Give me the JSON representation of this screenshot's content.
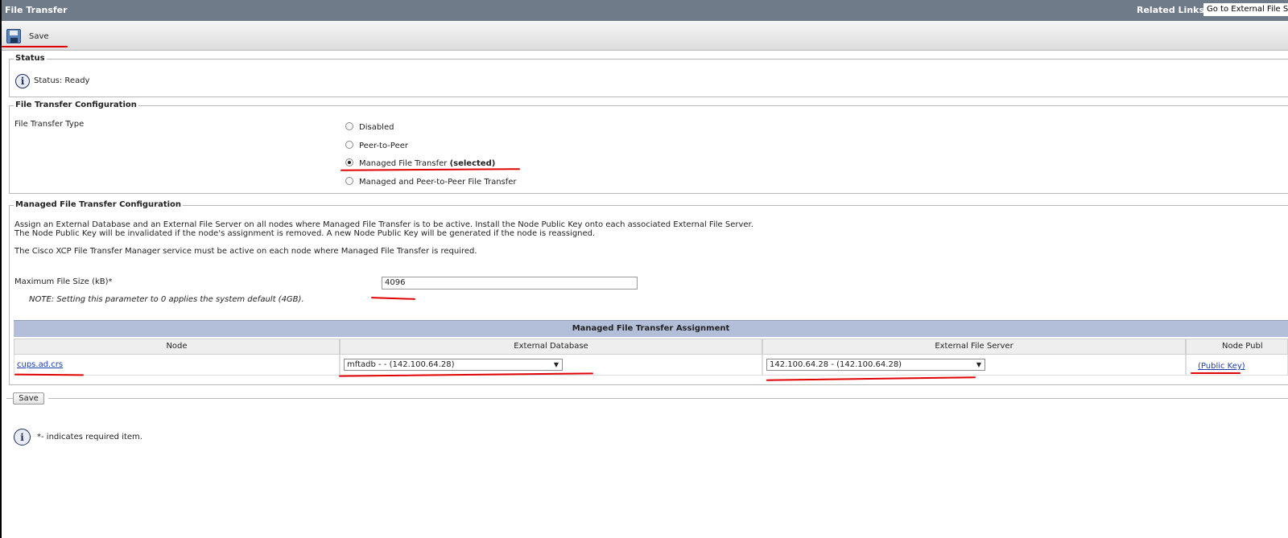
{
  "window": {
    "title": "File Transfer",
    "related_links_label": "Related Links:",
    "related_links_value": "Go to External File S"
  },
  "toolbar": {
    "save_label": "Save",
    "save_icon": "floppy-disk-icon"
  },
  "status": {
    "legend": "Status",
    "text": "Status: Ready",
    "icon": "info-icon"
  },
  "ft_config": {
    "legend": "File Transfer Configuration",
    "type_label": "File Transfer Type",
    "options": [
      {
        "label": "Disabled",
        "suffix": "",
        "checked": false
      },
      {
        "label": "Peer-to-Peer",
        "suffix": "",
        "checked": false
      },
      {
        "label": "Managed File Transfer",
        "suffix": "(selected)",
        "checked": true
      },
      {
        "label": "Managed and Peer-to-Peer File Transfer",
        "suffix": "",
        "checked": false
      }
    ]
  },
  "mft_config": {
    "legend": "Managed File Transfer Configuration",
    "desc_line1": "Assign an External Database and an External File Server on all nodes where Managed File Transfer is to be active. Install the Node Public Key onto each associated External File Server.",
    "desc_line2": "The Node Public Key will be invalidated if the node's assignment is removed. A new Node Public Key will be generated if the node is reassigned.",
    "desc_line3": "The Cisco XCP File Transfer Manager service must be active on each node where Managed File Transfer is required.",
    "max_size_label": "Maximum File Size (kB)*",
    "max_size_value": "4096",
    "note": "NOTE: Setting this parameter to 0 applies the system default (4GB)."
  },
  "assignment": {
    "title": "Managed File Transfer Assignment",
    "columns": [
      "Node",
      "External Database",
      "External File Server",
      "Node Publ"
    ],
    "rows": [
      {
        "node": "cups.ad.crs",
        "external_database": "mftadb - - (142.100.64.28)",
        "external_file_server": "142.100.64.28 - (142.100.64.28)",
        "public_key": "(Public Key)"
      }
    ]
  },
  "footer": {
    "save_label": "Save",
    "required_note": "*- indicates required item."
  },
  "colors": {
    "titlebar": "#6f7b89",
    "table_header": "#b3bfd8",
    "annotation": "#e00000",
    "link": "#1a3ea8"
  }
}
